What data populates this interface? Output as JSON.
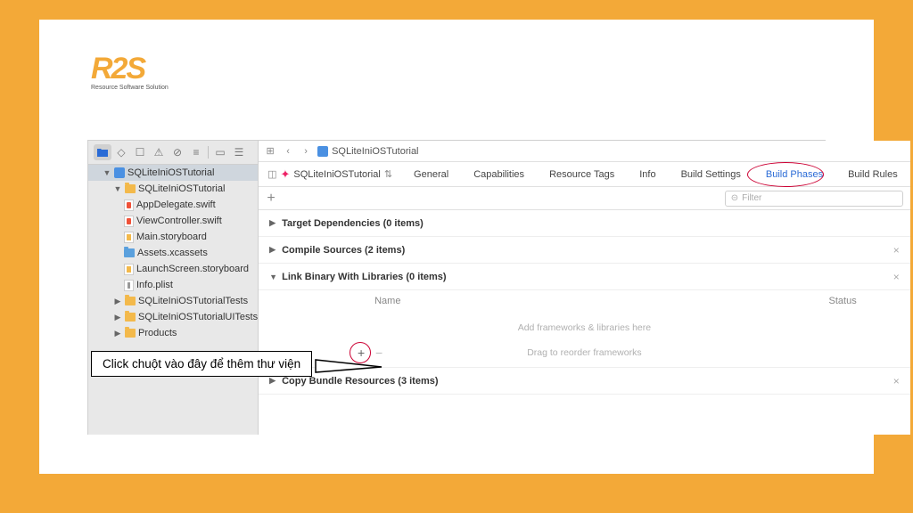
{
  "logo": {
    "text": "R2S",
    "subtitle": "Resource Software Solution"
  },
  "breadcrumb": {
    "project": "SQLiteIniOSTutorial"
  },
  "navigator": {
    "root": "SQLiteIniOSTutorial",
    "group": "SQLiteIniOSTutorial",
    "files": [
      "AppDelegate.swift",
      "ViewController.swift",
      "Main.storyboard",
      "Assets.xcassets",
      "LaunchScreen.storyboard",
      "Info.plist"
    ],
    "tests": "SQLiteIniOSTutorialTests",
    "uitests": "SQLiteIniOSTutorialUITests",
    "products": "Products"
  },
  "target": "SQLiteIniOSTutorial",
  "tabs": {
    "general": "General",
    "capabilities": "Capabilities",
    "resource_tags": "Resource Tags",
    "info": "Info",
    "build_settings": "Build Settings",
    "build_phases": "Build Phases",
    "build_rules": "Build Rules"
  },
  "filter_placeholder": "Filter",
  "phases": {
    "target_deps": "Target Dependencies (0 items)",
    "compile": "Compile Sources (2 items)",
    "link": "Link Binary With Libraries (0 items)",
    "copy": "Copy Bundle Resources (3 items)"
  },
  "lib_section": {
    "col_name": "Name",
    "col_status": "Status",
    "placeholder": "Add frameworks & libraries here",
    "drag_hint": "Drag to reorder frameworks"
  },
  "callout": "Click chuột vào đây để thêm thư viện"
}
